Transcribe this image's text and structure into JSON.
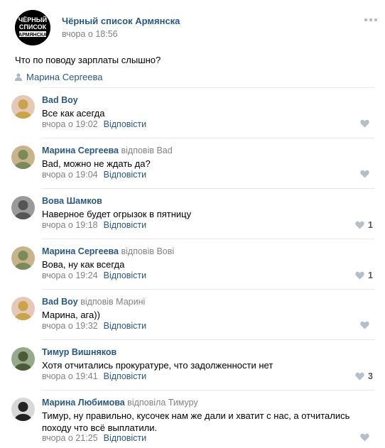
{
  "post": {
    "group_name": "Чёрный список Армянска",
    "logo_text": [
      "ЧЁРНЫЙ",
      "СПИСОК",
      "АРМЯНСКА"
    ],
    "time": "вчора о 18:56",
    "text": "Что по поводу зарплаты слышно?",
    "signer": "Марина Сергеева"
  },
  "reply_label": "Відповісти",
  "comments": [
    {
      "author": "Bad Boy",
      "reply_to": "",
      "text": "Все как асегда",
      "time": "вчора о 19:02",
      "likes": ""
    },
    {
      "author": "Марина Сергеева",
      "reply_to": "відповів Bad",
      "text": "Bad, можно не ждать да?",
      "time": "вчора о 19:04",
      "likes": ""
    },
    {
      "author": "Вова Шамков",
      "reply_to": "",
      "text": "Наверное будет огрызок в пятницу",
      "time": "вчора о 19:18",
      "likes": "1"
    },
    {
      "author": "Марина Сергеева",
      "reply_to": "відповів Вові",
      "text": "Вова, ну как всегда",
      "time": "вчора о 19:24",
      "likes": "1"
    },
    {
      "author": "Bad Boy",
      "reply_to": "відповів Марині",
      "text": "Марина, ага))",
      "time": "вчора о 19:32",
      "likes": ""
    },
    {
      "author": "Тимур Вишняков",
      "reply_to": "",
      "text": "Хотя отчитались прокуратуре, что задолженности нет",
      "time": "вчора о 19:41",
      "likes": "3"
    },
    {
      "author": "Марина Любимова",
      "reply_to": "відповіла Тимуру",
      "text": "Тимур, ну правильно, кусочек нам же дали и хватит с нас, а отчитались походу что всё выплатили.",
      "time": "вчора о 21:25",
      "likes": ""
    }
  ],
  "colors": {
    "link": "#2a5885",
    "muted": "#828282",
    "divider": "#e7e8ec"
  }
}
